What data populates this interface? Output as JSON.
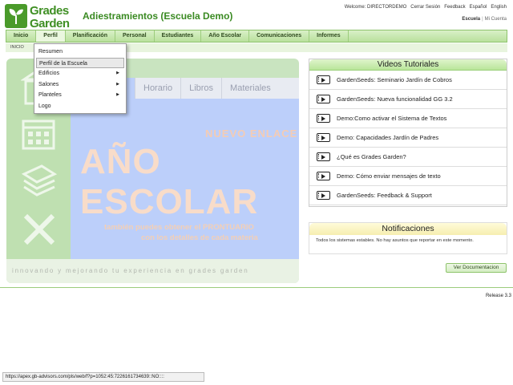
{
  "brand": {
    "line1": "Grades",
    "line2": "Garden"
  },
  "app_title": "Adiestramientos (Escuela Demo)",
  "topbar": {
    "welcome": "Welcome: DIRECTORDEMO",
    "logout": "Cerrar Sesión",
    "feedback": "Feedback",
    "lang_es": "Español",
    "lang_en": "English"
  },
  "escuela_links": {
    "current": "Escuela",
    "sep": "|",
    "other": "Mi Cuenta"
  },
  "nav": {
    "items": [
      "Inicio",
      "Perfil",
      "Planificación",
      "Personal",
      "Estudiantes",
      "Año Escolar",
      "Comunicaciones",
      "Informes"
    ],
    "breadcrumb": "INICIO"
  },
  "dropdown": {
    "items": [
      {
        "label": "Resumen"
      },
      {
        "label": "Perfil de la Escuela"
      },
      {
        "label": "Edificios",
        "arrow": "▶"
      },
      {
        "label": "Salones",
        "arrow": "▶"
      },
      {
        "label": "Planteles",
        "arrow": "▶"
      },
      {
        "label": "Logo"
      }
    ]
  },
  "banner": {
    "tabs": [
      "Horario",
      "Libros",
      "Materiales"
    ],
    "kicker": "NUEVO ENLACE",
    "headline": "AÑO ESCOLAR",
    "sub1": "también puedes obtener el PRONTUARIO",
    "sub2": "con los detalles de cada materia",
    "footer": "innovando y mejorando tu experiencia en grades garden"
  },
  "tutorials": {
    "title": "Videos Tutoriales",
    "items": [
      "GardenSeeds: Seminario Jardín de Cobros",
      "GardenSeeds: Nueva funcionalidad GG 3.2",
      "Demo:Como activar el Sistema de Textos",
      "Demo: Capacidades Jardín de Padres",
      "¿Qué es Grades Garden?",
      "Demo: Cómo enviar mensajes de texto",
      "GardenSeeds: Feedback & Support"
    ]
  },
  "notifications": {
    "title": "Notificaciones",
    "body": "Todos los sistemas estables. No hay asuntos que reportar en este momento."
  },
  "ver_doc": "Ver Documentacion",
  "release": "Release 3.3",
  "statusbar": "https://apex.gb-advisors.com/pls/web/f?p=1052:45:7226161734639::NO::::",
  "colors": {
    "brand_green": "#3f8f24",
    "nav_green": "#b9e09c",
    "banner_blue": "#bccffa",
    "notif_yellow": "#f6eeb0"
  }
}
